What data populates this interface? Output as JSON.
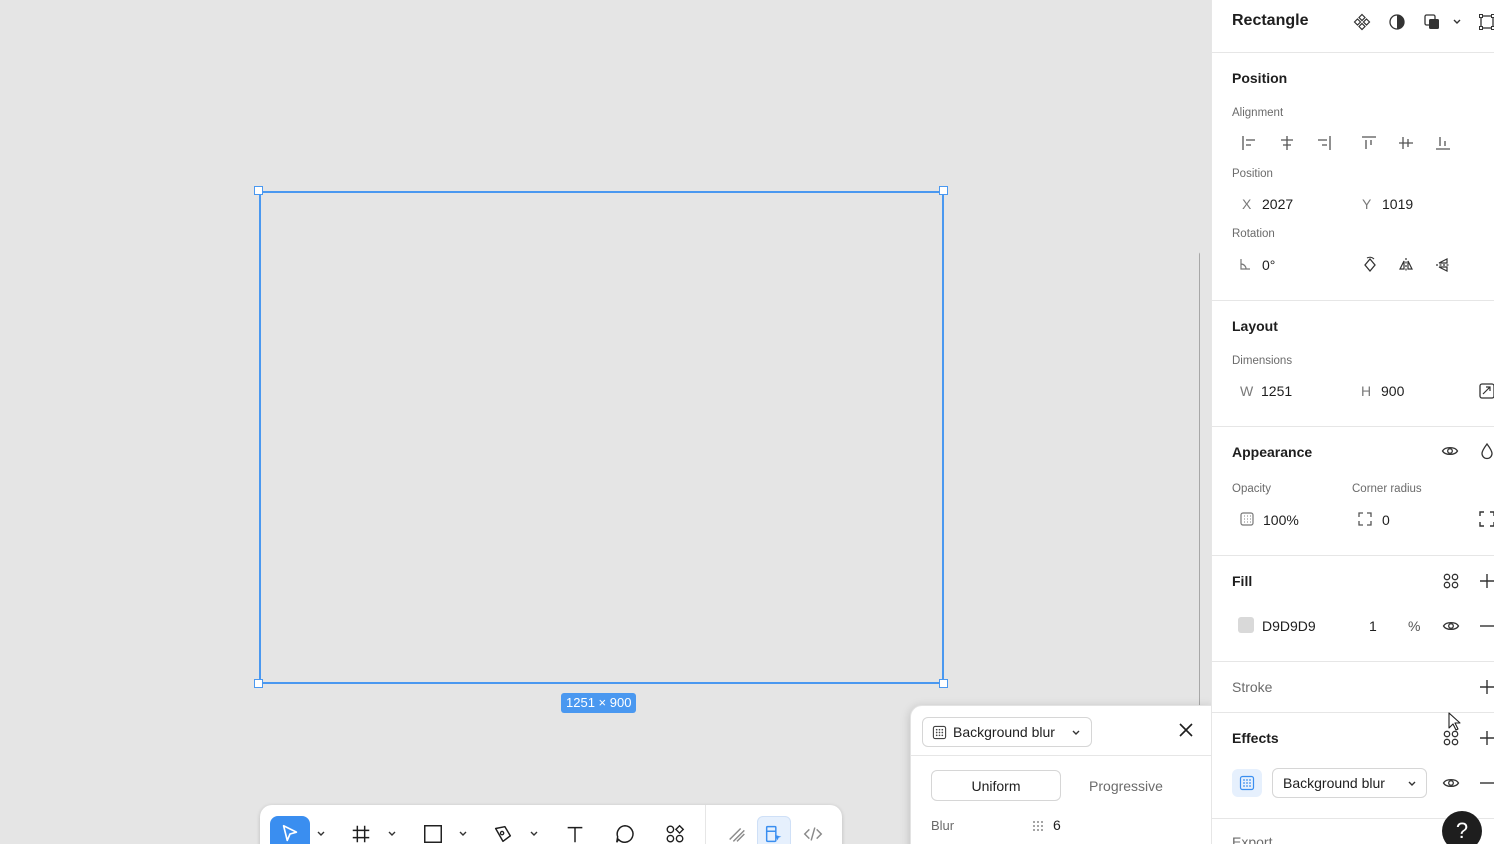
{
  "canvas": {
    "dimension_badge": "1251 × 900"
  },
  "toolbar": {
    "tools": [
      "move-icon",
      "frame-icon",
      "rectangle-icon",
      "pen-icon",
      "text-icon",
      "comment-icon",
      "components-icon",
      "draw-icon",
      "dev-handoff-icon",
      "code-icon"
    ],
    "active_color": "#3a8ef0"
  },
  "panel": {
    "title": "Rectangle",
    "position": {
      "section_title": "Position",
      "alignment_label": "Alignment",
      "position_label": "Position",
      "x_letter": "X",
      "x_value": "2027",
      "y_letter": "Y",
      "y_value": "1019",
      "rotation_label": "Rotation",
      "rotation_value": "0°"
    },
    "layout": {
      "section_title": "Layout",
      "dimensions_label": "Dimensions",
      "w_letter": "W",
      "w_value": "1251",
      "h_letter": "H",
      "h_value": "900"
    },
    "appearance": {
      "section_title": "Appearance",
      "opacity_label": "Opacity",
      "opacity_value": "100%",
      "corner_radius_label": "Corner radius",
      "corner_radius_value": "0"
    },
    "fill": {
      "section_title": "Fill",
      "hex": "D9D9D9",
      "opacity": "1",
      "percent": "%",
      "swatch_color": "#d9d9d9"
    },
    "stroke": {
      "section_title": "Stroke"
    },
    "effects": {
      "section_title": "Effects",
      "effect_type": "Background blur"
    },
    "export": {
      "section_title": "Export"
    },
    "help_label": "?"
  },
  "popover": {
    "effect_type": "Background blur",
    "segment_uniform": "Uniform",
    "segment_progressive": "Progressive",
    "blur_label": "Blur",
    "blur_value": "6"
  },
  "colors": {
    "accent": "#4a98f0",
    "canvas_bg": "#e5e5e5"
  }
}
